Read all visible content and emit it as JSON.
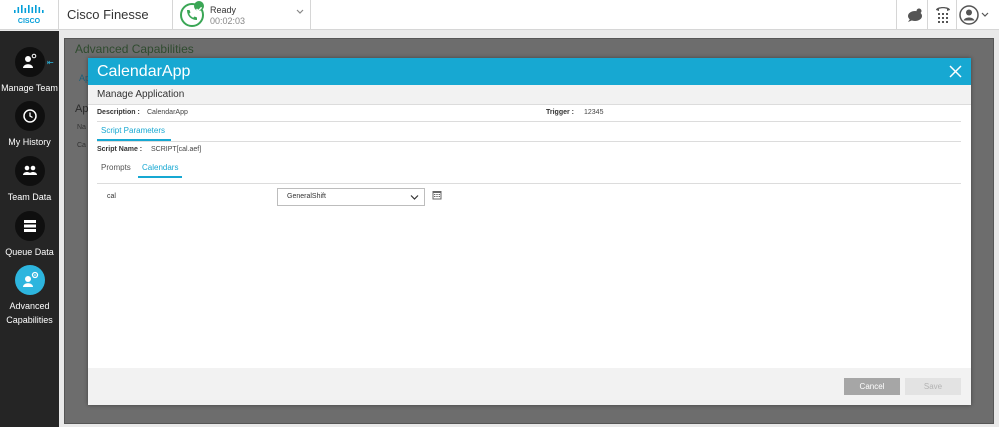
{
  "topbar": {
    "logo_text": "CISCO",
    "app_title": "Cisco Finesse",
    "status": {
      "label": "Ready",
      "timer": "00:02:03",
      "color": "#3aa655"
    },
    "icons": [
      "chat-icon",
      "dialpad-icon",
      "user-profile-icon"
    ]
  },
  "leftnav": {
    "items": [
      {
        "label": "Manage Team",
        "icon": "manage-team-icon",
        "active": false
      },
      {
        "label": "My History",
        "icon": "history-icon",
        "active": false
      },
      {
        "label": "Team Data",
        "icon": "team-data-icon",
        "active": false
      },
      {
        "label": "Queue Data",
        "icon": "queue-data-icon",
        "active": false
      },
      {
        "label_line1": "Advanced",
        "label_line2": "Capabilities",
        "icon": "advanced-capabilities-icon",
        "active": true
      }
    ]
  },
  "background_page": {
    "title": "Advanced Capabilities",
    "frag_tab": "Ap",
    "frag_heading": "Ap",
    "frag_col": "Na",
    "frag_row": "Ca"
  },
  "modal": {
    "title": "CalendarApp",
    "subheader": "Manage Application",
    "description_label": "Description :",
    "description_value": "CalendarApp",
    "trigger_label": "Trigger :",
    "trigger_value": "12345",
    "section_tab": "Script Parameters",
    "script_name_label": "Script Name :",
    "script_name_value": "SCRIPT[cal.aef]",
    "tabs": [
      {
        "label": "Prompts",
        "active": false
      },
      {
        "label": "Calendars",
        "active": true
      }
    ],
    "calendar_row": {
      "label": "cal",
      "selected": "GeneralShift"
    },
    "buttons": {
      "cancel": "Cancel",
      "save": "Save"
    }
  },
  "colors": {
    "accent": "#17a8d2",
    "nav_bg": "#252525",
    "active_nav": "#2db5de"
  }
}
